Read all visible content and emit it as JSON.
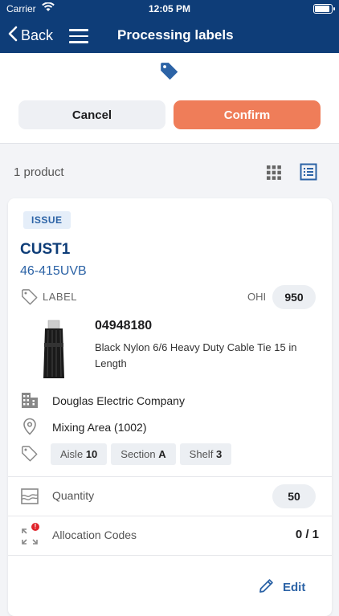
{
  "status_bar": {
    "carrier": "Carrier",
    "time": "12:05 PM"
  },
  "nav": {
    "back_label": "Back",
    "title": "Processing labels"
  },
  "actions": {
    "cancel_label": "Cancel",
    "confirm_label": "Confirm"
  },
  "list": {
    "count_label": "1 product"
  },
  "card": {
    "badge": "ISSUE",
    "customer": "CUST1",
    "part_number": "46-415UVB",
    "label_type": "LABEL",
    "ohi_label": "OHI",
    "ohi_value": "950",
    "product_number": "04948180",
    "product_description": "Black Nylon 6/6 Heavy Duty Cable Tie 15 in Length",
    "company": "Douglas Electric Company",
    "location": "Mixing Area (1002)",
    "aisle_label": "Aisle",
    "aisle_value": "10",
    "section_label": "Section",
    "section_value": "A",
    "shelf_label": "Shelf",
    "shelf_value": "3",
    "quantity_label": "Quantity",
    "quantity_value": "50",
    "allocation_label": "Allocation Codes",
    "allocation_value": "0 / 1",
    "allocation_alert": "!",
    "edit_label": "Edit"
  },
  "colors": {
    "nav": "#0e3d78",
    "accent": "#ef7d59",
    "link": "#2c63a6"
  },
  "icons": [
    "wifi-icon",
    "battery-icon",
    "back-chevron-icon",
    "menu-icon",
    "tag-icon",
    "grid-view-icon",
    "list-view-icon",
    "building-icon",
    "location-pin-icon",
    "quantity-icon",
    "expand-icon",
    "pencil-icon"
  ]
}
